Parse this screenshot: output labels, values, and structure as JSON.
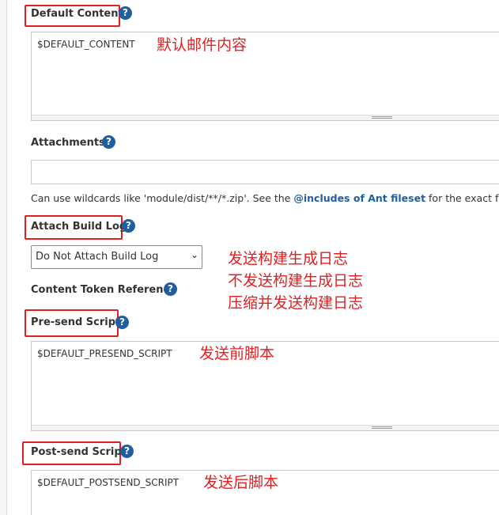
{
  "sections": {
    "default_content": {
      "label": "Default Content",
      "value": "$DEFAULT_CONTENT",
      "annotation": "默认邮件内容"
    },
    "attachments": {
      "label": "Attachments",
      "value": "",
      "hint_prefix": "Can use wildcards like 'module/dist/**/*.zip'. See the ",
      "hint_link": "@includes of Ant fileset",
      "hint_suffix": " for the exact form"
    },
    "attach_build_log": {
      "label": "Attach Build Log",
      "selected": "Do Not Attach Build Log",
      "annotations": [
        "发送构建生成日志",
        "不发送构建生成日志",
        "压缩并发送构建日志"
      ]
    },
    "content_token_reference": {
      "label": "Content Token Reference"
    },
    "pre_send_script": {
      "label": "Pre-send Script",
      "value": "$DEFAULT_PRESEND_SCRIPT",
      "annotation": "发送前脚本"
    },
    "post_send_script": {
      "label": "Post-send Script",
      "value": "$DEFAULT_POSTSEND_SCRIPT",
      "annotation": "发送后脚本"
    }
  },
  "icons": {
    "help": "help-icon",
    "chevron": "chevron-down-icon"
  },
  "colors": {
    "highlight_box": "#e02020",
    "annotation_text": "#e02020",
    "help_icon": "#1f5fa0",
    "link": "#1f5fa0"
  }
}
